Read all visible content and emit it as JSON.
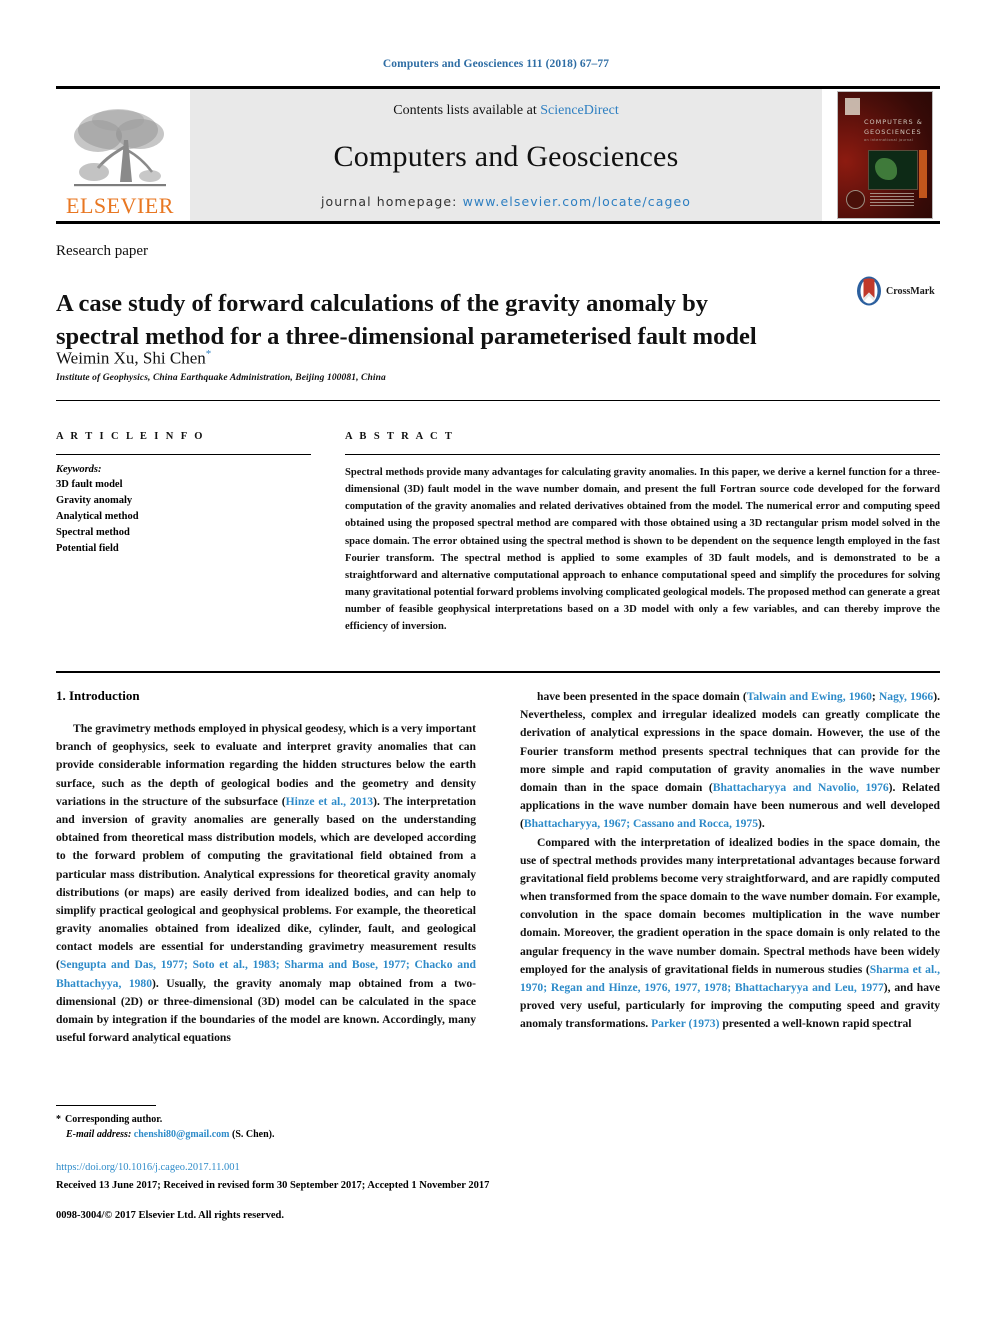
{
  "running_head": "Computers and Geosciences 111 (2018) 67–77",
  "masthead": {
    "publisher_name": "ELSEVIER",
    "contents_prefix": "Contents lists available at ",
    "contents_link": "ScienceDirect",
    "journal_title": "Computers and Geosciences",
    "homepage_prefix": "journal homepage: ",
    "homepage_url": "www.elsevier.com/locate/cageo",
    "cover": {
      "title_line1": "COMPUTERS &",
      "title_line2": "GEOSCIENCES",
      "subtitle": "an international journal"
    }
  },
  "article": {
    "type_label": "Research paper",
    "title": "A case study of forward calculations of the gravity anomaly by spectral method for a three-dimensional parameterised fault model",
    "authors": "Weimin Xu, Shi Chen",
    "corresponding_marker": "*",
    "affiliation": "Institute of Geophysics, China Earthquake Administration, Beijing 100081, China",
    "crossmark_label": "CrossMark"
  },
  "article_info": {
    "heading": "A R T I C L E   I N F O",
    "keywords_label": "Keywords:",
    "keywords": [
      "3D fault model",
      "Gravity anomaly",
      "Analytical method",
      "Spectral method",
      "Potential field"
    ]
  },
  "abstract": {
    "heading": "A B S T R A C T",
    "text": "Spectral methods provide many advantages for calculating gravity anomalies. In this paper, we derive a kernel function for a three-dimensional (3D) fault model in the wave number domain, and present the full Fortran source code developed for the forward computation of the gravity anomalies and related derivatives obtained from the model. The numerical error and computing speed obtained using the proposed spectral method are compared with those obtained using a 3D rectangular prism model solved in the space domain. The error obtained using the spectral method is shown to be dependent on the sequence length employed in the fast Fourier transform. The spectral method is applied to some examples of 3D fault models, and is demonstrated to be a straightforward and alternative computational approach to enhance computational speed and simplify the procedures for solving many gravitational potential forward problems involving complicated geological models. The proposed method can generate a great number of feasible geophysical interpretations based on a 3D model with only a few variables, and can thereby improve the efficiency of inversion."
  },
  "body": {
    "section_number_title": "1.  Introduction",
    "left_column_paragraphs": [
      {
        "segments": [
          {
            "t": "The gravimetry methods employed in physical geodesy, which is a very important branch of geophysics, seek to evaluate and interpret gravity anomalies that can provide considerable information regarding the hidden structures below the earth surface, such as the depth of geological bodies and the geometry and density variations in the structure of the subsurface (",
            "ref": false
          },
          {
            "t": "Hinze et al., 2013",
            "ref": true
          },
          {
            "t": "). The interpretation and inversion of gravity anomalies are generally based on the understanding obtained from theoretical mass distribution models, which are developed according to the forward problem of computing the gravitational field obtained from a particular mass distribution. Analytical expressions for theoretical gravity anomaly distributions (or maps) are easily derived from idealized bodies, and can help to simplify practical geological and geophysical problems. For example, the theoretical gravity anomalies obtained from idealized dike, cylinder, fault, and geological contact models are essential for understanding gravimetry measurement results (",
            "ref": false
          },
          {
            "t": "Sengupta and Das, 1977; Soto et al., 1983; Sharma and Bose, 1977; Chacko and Bhattachyya, 1980",
            "ref": true
          },
          {
            "t": "). Usually, the gravity anomaly map obtained from a two-dimensional (2D) or three-dimensional (3D) model can be calculated in the space domain by integration if the boundaries of the model are known. Accordingly, many useful forward analytical equations",
            "ref": false
          }
        ]
      }
    ],
    "right_column_paragraphs": [
      {
        "segments": [
          {
            "t": "have been presented in the space domain (",
            "ref": false
          },
          {
            "t": "Talwain and Ewing, 1960",
            "ref": true
          },
          {
            "t": "; ",
            "ref": false
          },
          {
            "t": "Nagy, 1966",
            "ref": true
          },
          {
            "t": "). Nevertheless, complex and irregular idealized models can greatly complicate the derivation of analytical expressions in the space domain. However, the use of the Fourier transform method presents spectral techniques that can provide for the more simple and rapid computation of gravity anomalies in the wave number domain than in the space domain (",
            "ref": false
          },
          {
            "t": "Bhattacharyya and Navolio, 1976",
            "ref": true
          },
          {
            "t": "). Related applications in the wave number domain have been numerous and well developed (",
            "ref": false
          },
          {
            "t": "Bhattacharyya, 1967; Cassano and Rocca, 1975",
            "ref": true
          },
          {
            "t": ").",
            "ref": false
          }
        ]
      },
      {
        "segments": [
          {
            "t": "Compared with the interpretation of idealized bodies in the space domain, the use of spectral methods provides many interpretational advantages because forward gravitational field problems become very straightforward, and are rapidly computed when transformed from the space domain to the wave number domain. For example, convolution in the space domain becomes multiplication in the wave number domain. Moreover, the gradient operation in the space domain is only related to the angular frequency in the wave number domain. Spectral methods have been widely employed for the analysis of gravitational fields in numerous studies (",
            "ref": false
          },
          {
            "t": "Sharma et al., 1970; Regan and Hinze, 1976, 1977, 1978; Bhattacharyya and Leu, 1977",
            "ref": true
          },
          {
            "t": "), and have proved very useful, particularly for improving the computing speed and gravity anomaly transformations. ",
            "ref": false
          },
          {
            "t": "Parker (1973)",
            "ref": true
          },
          {
            "t": " presented a well-known rapid spectral",
            "ref": false
          }
        ]
      }
    ]
  },
  "footer": {
    "corresponding_author_marker": "*",
    "corresponding_author": "Corresponding author.",
    "email_label": "E-mail address:",
    "email": "chenshi80@gmail.com",
    "email_owner": "(S. Chen).",
    "doi": "https://doi.org/10.1016/j.cageo.2017.11.001",
    "received": "Received 13 June 2017; Received in revised form 30 September 2017; Accepted 1 November 2017",
    "copyright": "0098-3004/© 2017 Elsevier Ltd. All rights reserved."
  },
  "colors": {
    "link_blue": "#2e8bc9",
    "elsevier_orange": "#E87722",
    "masthead_gray": "#e9e9e9"
  }
}
